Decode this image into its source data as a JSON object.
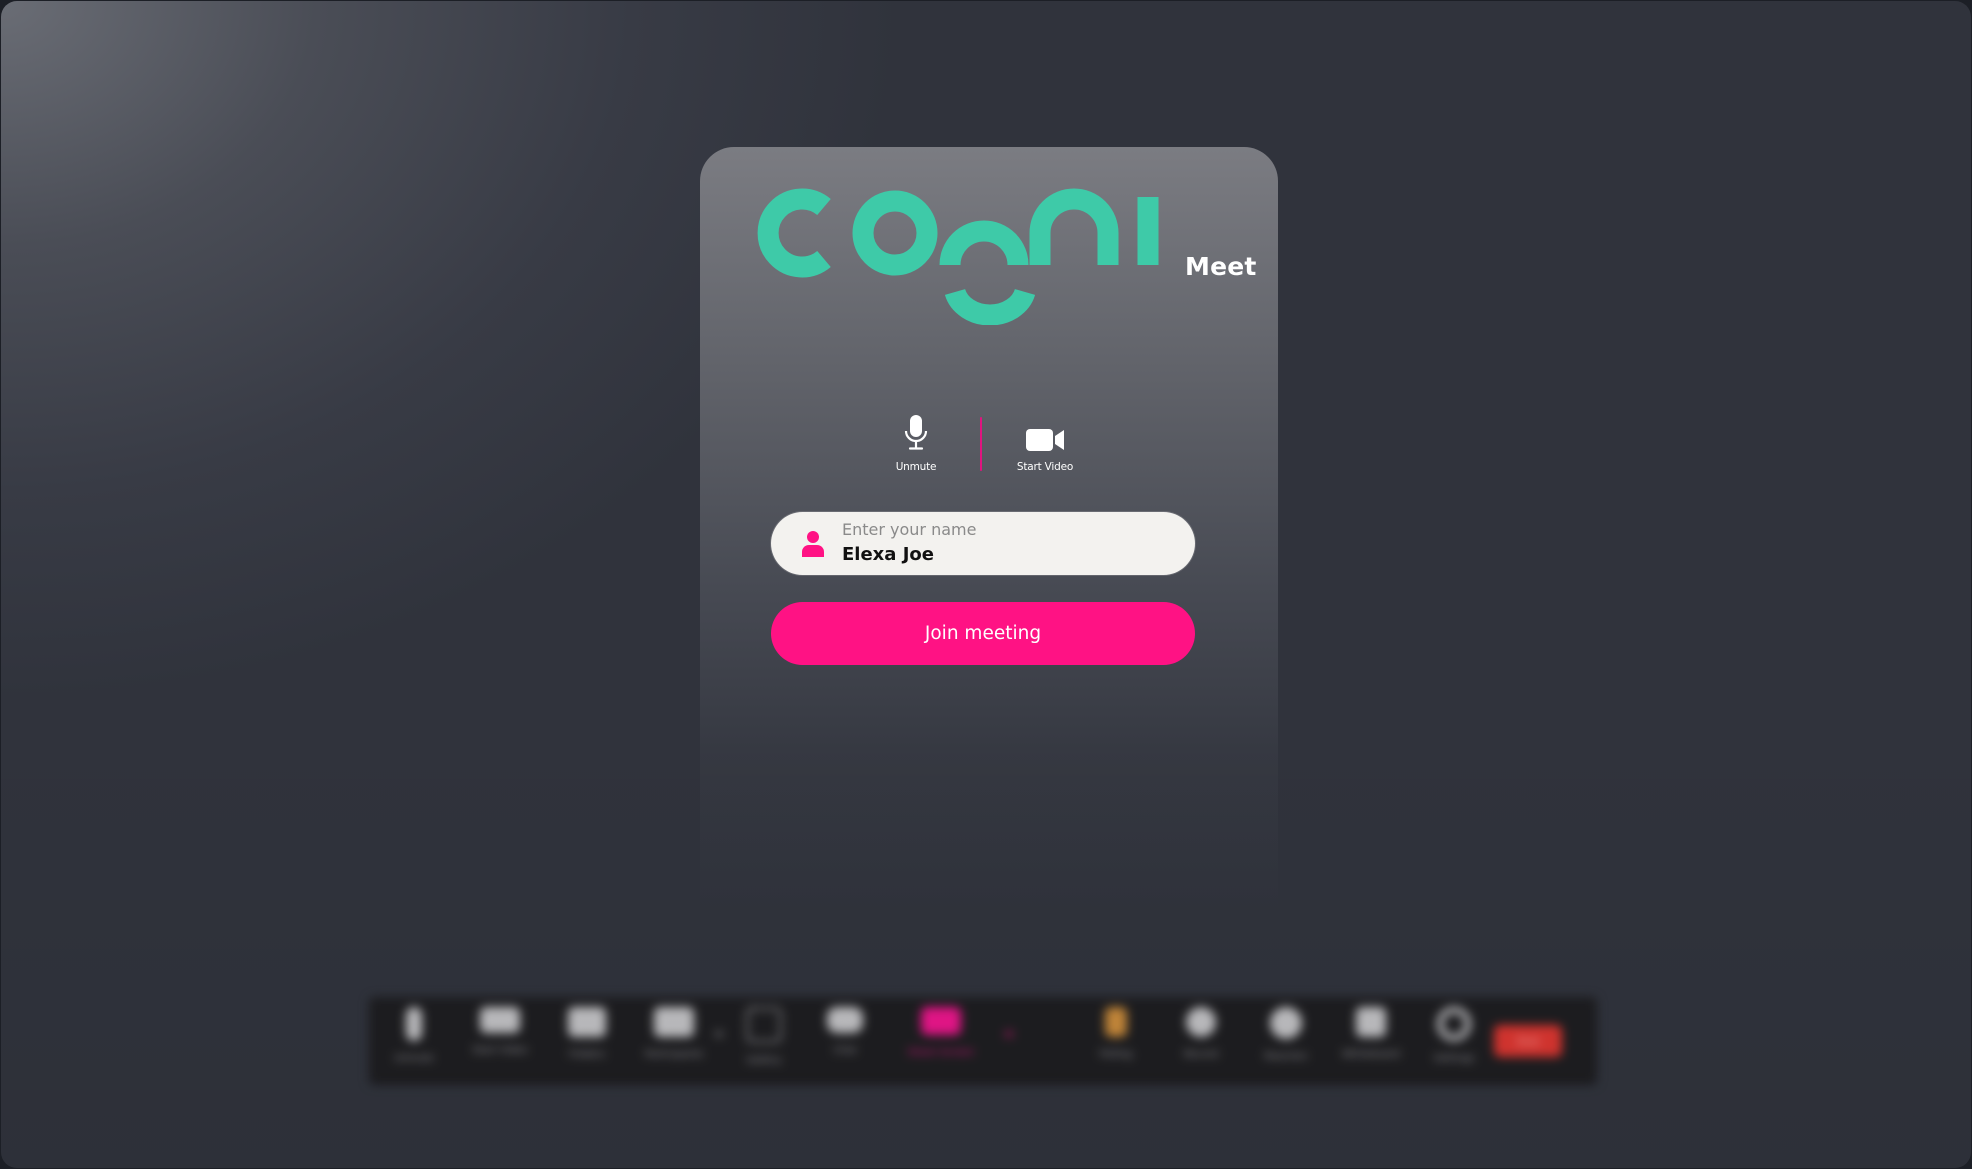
{
  "app": {
    "brand_name": "cogni",
    "brand_suffix": "Meet",
    "colors": {
      "brand_teal": "#3ecaa8",
      "accent_pink": "#ff1284",
      "field_bg": "#f3f2ef",
      "end_red": "#d83530"
    }
  },
  "av_controls": {
    "mute": {
      "label": "Unmute",
      "icon": "microphone-icon"
    },
    "video": {
      "label": "Start Video",
      "icon": "video-camera-icon"
    }
  },
  "join_form": {
    "name_placeholder": "Enter your name",
    "name_value": "Elexa Joe",
    "name_icon": "user-icon",
    "join_label": "Join meeting"
  },
  "toolbar": {
    "items": [
      {
        "label": "Unmute",
        "icon": "microphone-icon"
      },
      {
        "label": "Start Video",
        "icon": "video-camera-icon"
      },
      {
        "label": "Folders",
        "icon": "folder-icon"
      },
      {
        "label": "Participants",
        "icon": "participants-icon"
      },
      {
        "label": "Gallery",
        "icon": "grid-icon"
      },
      {
        "label": "Chat",
        "icon": "chat-icon"
      },
      {
        "label": "Share Screen",
        "icon": "share-screen-icon",
        "active": true
      },
      {
        "label": "Polling",
        "icon": "polling-icon"
      },
      {
        "label": "Record",
        "icon": "record-icon"
      },
      {
        "label": "Reaction",
        "icon": "reaction-icon"
      },
      {
        "label": "Whiteboard",
        "icon": "whiteboard-icon"
      },
      {
        "label": "Settings",
        "icon": "gear-icon"
      }
    ],
    "end_label": "End"
  }
}
